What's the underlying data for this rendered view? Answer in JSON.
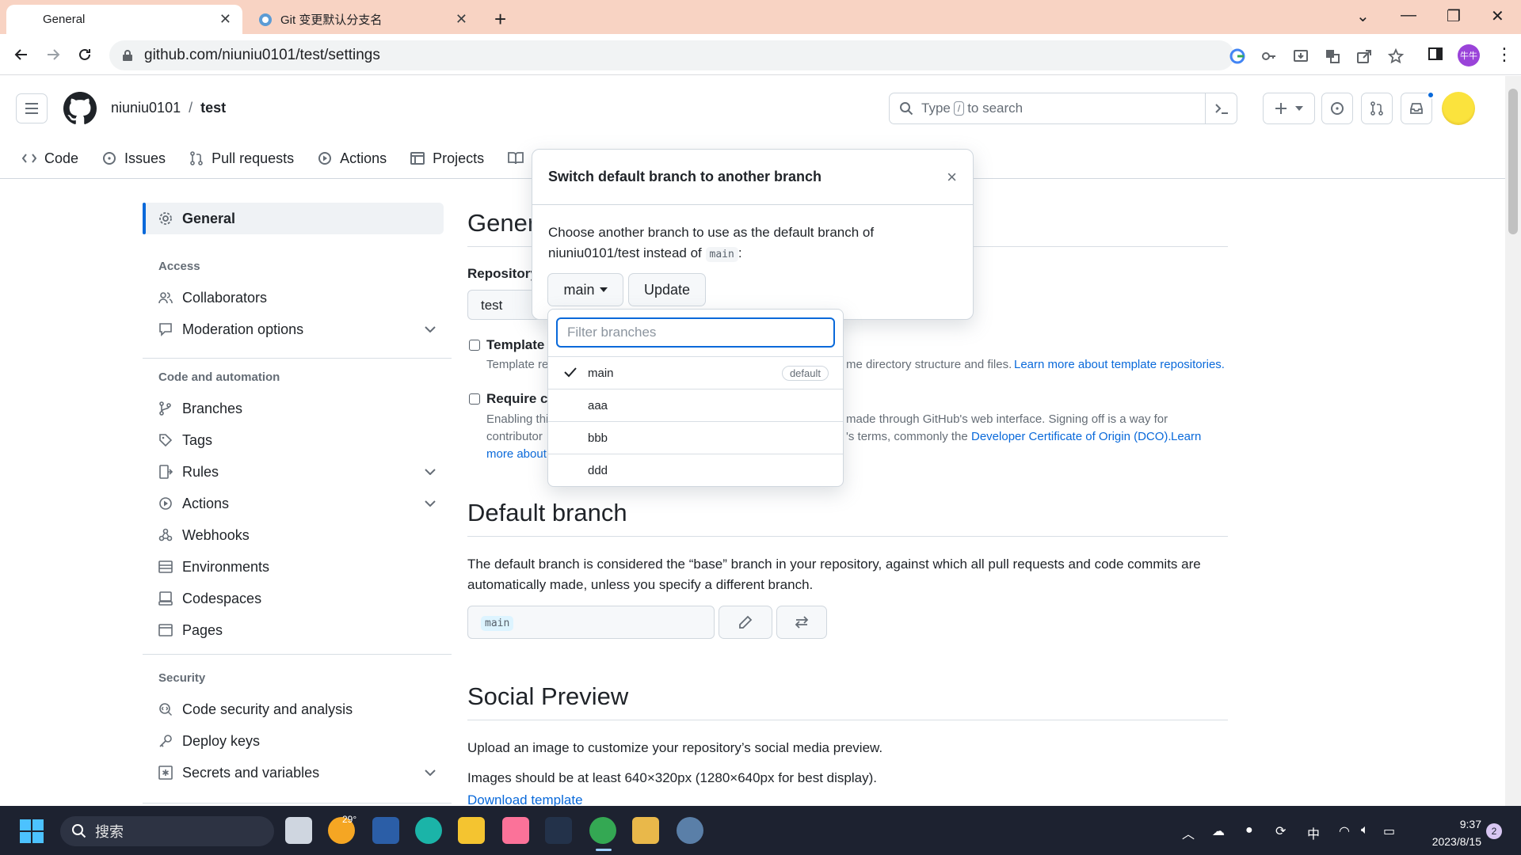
{
  "browser": {
    "tabs": [
      {
        "title": "General",
        "active": true
      },
      {
        "title": "Git 变更默认分支名",
        "active": false
      }
    ],
    "url": "github.com/niuniu0101/test/settings",
    "profile_initials": "牛牛"
  },
  "header": {
    "owner": "niuniu0101",
    "separator": "/",
    "repo": "test",
    "search": {
      "prefix": "Type",
      "key": "/",
      "suffix": "to search"
    }
  },
  "repo_nav": [
    {
      "label": "Code",
      "icon": "code-icon"
    },
    {
      "label": "Issues",
      "icon": "issue-icon"
    },
    {
      "label": "Pull requests",
      "icon": "pull-request-icon"
    },
    {
      "label": "Actions",
      "icon": "play-icon"
    },
    {
      "label": "Projects",
      "icon": "table-icon"
    }
  ],
  "sidebar": {
    "general": "General",
    "access_heading": "Access",
    "access": [
      "Collaborators",
      "Moderation options"
    ],
    "code_heading": "Code and automation",
    "code": [
      "Branches",
      "Tags",
      "Rules",
      "Actions",
      "Webhooks",
      "Environments",
      "Codespaces",
      "Pages"
    ],
    "security_heading": "Security",
    "security": [
      "Code security and analysis",
      "Deploy keys",
      "Secrets and variables"
    ]
  },
  "main": {
    "general_title": "Gener",
    "repo_label": "Repository",
    "repo_value": "test",
    "template_label": "Template",
    "template_desc_start": "Template re",
    "template_desc_end": "me directory structure and files.",
    "template_link": "Learn more about template repositories.",
    "require_label": "Require c",
    "require_desc_1a": "Enabling thi",
    "require_desc_1b": "made through GitHub's web interface. Signing off is a way for",
    "require_desc_2a": "contributor",
    "require_desc_2b": "'s terms, commonly the",
    "dco_link": "Developer Certificate of Origin (DCO).",
    "learn": "Learn",
    "more_about": "more about",
    "default_branch_title": "Default branch",
    "default_branch_desc": "The default branch is considered the “base” branch in your repository, against which all pull requests and code commits are automatically made, unless you specify a different branch.",
    "default_branch_value": "main",
    "social_title": "Social Preview",
    "social_desc": "Upload an image to customize your repository’s social media preview.",
    "social_size": "Images should be at least 640×320px (1280×640px for best display).",
    "download_template": "Download template"
  },
  "modal": {
    "title": "Switch default branch to another branch",
    "close": "×",
    "body_1": "Choose another branch to use as the default branch of",
    "body_2": "niuniu0101/test instead of",
    "body_code": "main",
    "body_colon": ":",
    "select_label": "main",
    "update_label": "Update"
  },
  "dropdown": {
    "placeholder": "Filter branches",
    "branches": [
      {
        "name": "main",
        "badge": "default",
        "selected": true
      },
      {
        "name": "aaa"
      },
      {
        "name": "bbb"
      },
      {
        "name": "ddd"
      }
    ]
  },
  "taskbar": {
    "search": "搜索",
    "weather": "29°",
    "ime": "中",
    "time": "9:37",
    "date": "2023/8/15",
    "notifications": "2"
  },
  "colors": {
    "accent": "#0969da",
    "tabstrip": "#f8d3c3",
    "taskbar": "#1d2230"
  }
}
